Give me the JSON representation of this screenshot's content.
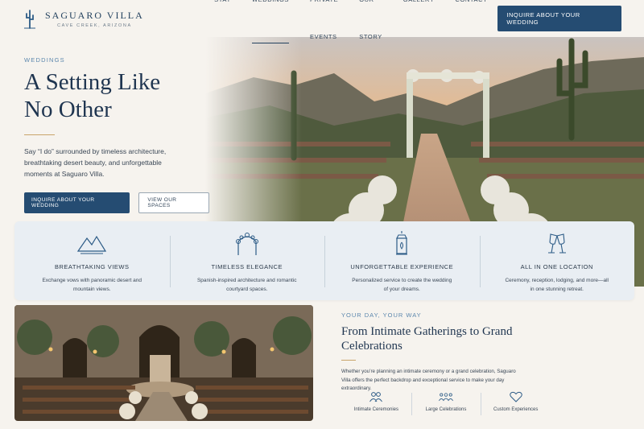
{
  "brand": {
    "name": "SAGUARO VILLA",
    "location": "CAVE CREEK, ARIZONA"
  },
  "nav": {
    "items": [
      {
        "label": "STAY"
      },
      {
        "label": "WEDDINGS",
        "active": true
      },
      {
        "label": "PRIVATE EVENTS"
      },
      {
        "label": "OUR STORY"
      },
      {
        "label": "GALLERY"
      },
      {
        "label": "CONTACT"
      }
    ],
    "cta": "INQUIRE ABOUT YOUR WEDDING"
  },
  "hero": {
    "eyebrow": "WEDDINGS",
    "title_line1": "A Setting Like",
    "title_line2": "No Other",
    "description": "Say “I do” surrounded by timeless architecture, breathtaking desert beauty, and unforgettable moments at Saguaro Villa.",
    "primary_button": "INQUIRE ABOUT YOUR WEDDING",
    "secondary_button": "VIEW OUR SPACES"
  },
  "features": [
    {
      "icon": "mountains-icon",
      "title": "BREATHTAKING VIEWS",
      "desc": "Exchange vows with panoramic desert and mountain views."
    },
    {
      "icon": "floral-arch-icon",
      "title": "TIMELESS ELEGANCE",
      "desc": "Spanish-inspired architecture and romantic courtyard spaces."
    },
    {
      "icon": "lantern-icon",
      "title": "UNFORGETTABLE EXPERIENCE",
      "desc": "Personalized service to create the wedding of your dreams."
    },
    {
      "icon": "champagne-icon",
      "title": "ALL IN ONE LOCATION",
      "desc": "Ceremony, reception, lodging, and more—all in one stunning retreat."
    }
  ],
  "lower": {
    "eyebrow": "YOUR DAY, YOUR WAY",
    "title": "From Intimate Gatherings to Grand Celebrations",
    "description": "Whether you’re planning an intimate ceremony or a grand celebration, Saguaro Villa offers the perfect backdrop and exceptional service to make your day extraordinary.",
    "options": [
      {
        "icon": "couple-icon",
        "label": "Intimate Ceremonies"
      },
      {
        "icon": "group-icon",
        "label": "Large Celebrations"
      },
      {
        "icon": "heart-icon",
        "label": "Custom Experiences"
      }
    ]
  },
  "colors": {
    "navy": "#254c72",
    "gold": "#c9a46a",
    "accent_blue": "#5c87ad",
    "background": "#f6f3ee"
  }
}
